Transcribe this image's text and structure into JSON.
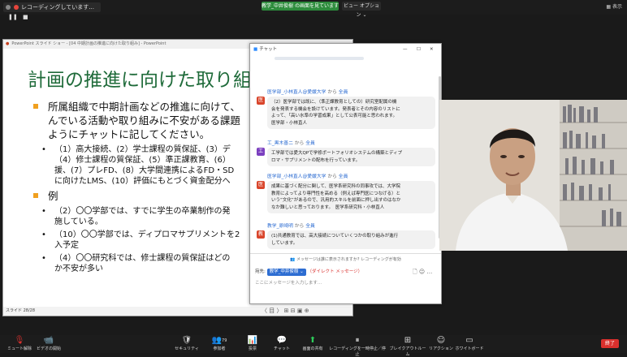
{
  "top_bar": {
    "recording_label": "レコーディングしています...",
    "share_banner": "教学_中井俊樹 の画面を見ています",
    "view_options": "ビュー オプション ⌄",
    "display_label": "表示"
  },
  "ppt": {
    "title_bar": "PowerPoint スライド ショー - [04 中期計画の推進に向けた取り組み] - PowerPoint",
    "slide_title": "計画の推進に向けた取り組み",
    "bullets": [
      {
        "text_lines": [
          "所属組織で中期計画などの推進に向けて、",
          "んでいる活動や取り組みに不安がある課題",
          "ようにチャットに記してください。"
        ],
        "sub": [
          [
            "（1）高大接続、(2）学士課程の質保証、(3）デ",
            "（4）修士課程の質保証、(5）準正課教育、(6）",
            "援、(7）プレFD、(8）大学間連携によるFD・SD",
            "に向けたLMS、(10）評価にもとづく資金配分へ"
          ]
        ]
      },
      {
        "text_lines": [
          "例"
        ],
        "sub": [
          [
            "（2）〇〇学部では、すでに学生の卒業制作の発",
            "施している。"
          ],
          [
            "（10）〇〇学部では、ディプロマサプリメントを2",
            "入予定"
          ],
          [
            "（4）〇〇研究科では、修士課程の質保証はどの",
            "か不安が多い"
          ]
        ]
      }
    ],
    "status": "スライド 28/28",
    "nav": "〈  目  〉  ⊞  ⊟  ▣  ⊕"
  },
  "chat": {
    "title": "チャット",
    "messages": [
      {
        "sender": "医学部_小林直人@愛媛大学",
        "from_word": "から",
        "target": "全員",
        "avatar_char": "医",
        "avatar_color": "#d9452b",
        "lines": [
          "（2）医学部では既に、（準正課教育としての）研究室配属の機",
          "会を発表する機会を設けています。発表者とその内容のリストに",
          "よって、「高い水準の学習成果」として公表可能と思われます。",
          "医学部・小林直人"
        ]
      },
      {
        "sender": "工_黒木善二",
        "from_word": "から",
        "target": "全員",
        "avatar_char": "工",
        "avatar_color": "#7b3fbf",
        "lines": [
          "工学部では愛大QPで学修ポートフォリオシステムの構築とディプ",
          "ロマ・サプリメントの配布を行っています。"
        ]
      },
      {
        "sender": "医学部_小林直人@愛媛大学",
        "from_word": "から",
        "target": "全員",
        "avatar_char": "医",
        "avatar_color": "#d9452b",
        "lines": [
          "成果に基づく配分に関して、医学系研究科の同事攻では、大学院",
          "教育によってより専門性を高める（例えば専門医につなげる）と",
          "いう”文化”があるので、汎用的スキルを前面に押し出すのはなか",
          "なか難しいと思っております。　医学系研究科・小林直人"
        ]
      },
      {
        "sender": "教学_原崎明",
        "from_word": "から",
        "target": "全員",
        "avatar_char": "教",
        "avatar_color": "#d9452b",
        "lines": [
          "(1)共通教育では、高大接続についていくつかの取り組みが進行",
          "しています。"
        ]
      }
    ],
    "notice": "メッセージは誰に表示されますか? レコーディングが有効",
    "to_label": "宛先:",
    "to_value": "教学_中井俊樹 ⌄",
    "to_dm": "（ダイレクト メッセージ）",
    "input_placeholder": "ここにメッセージを入力します..."
  },
  "bottom_bar": {
    "items": [
      {
        "icon": "microphone-icon",
        "glyph": "🎙",
        "label": "ミュート解除"
      },
      {
        "icon": "video-icon",
        "glyph": "📹",
        "label": "ビデオの開始"
      },
      {
        "icon": "security-icon",
        "glyph": "🛡",
        "label": "セキュリティ"
      },
      {
        "icon": "participants-icon",
        "glyph": "👥",
        "label": "参加者",
        "badge": "79"
      },
      {
        "icon": "poll-icon",
        "glyph": "📊",
        "label": "投票"
      },
      {
        "icon": "chat-icon",
        "glyph": "💬",
        "label": "チャット"
      },
      {
        "icon": "share-screen-icon",
        "glyph": "⬆",
        "label": "画面の共有"
      },
      {
        "icon": "record-icon",
        "glyph": "⏸",
        "label": "レコーディングを一時停止／停止"
      },
      {
        "icon": "breakout-icon",
        "glyph": "⊞",
        "label": "ブレイクアウトルーム"
      },
      {
        "icon": "reaction-icon",
        "glyph": "☺",
        "label": "リアクション"
      },
      {
        "icon": "whiteboard-icon",
        "glyph": "▭",
        "label": "ホワイトボード"
      }
    ],
    "end_label": "終了"
  }
}
